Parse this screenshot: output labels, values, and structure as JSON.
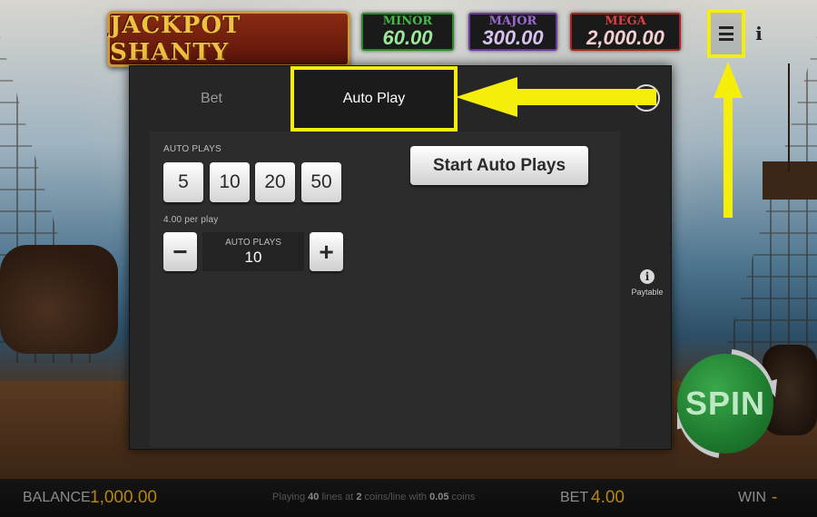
{
  "header": {
    "logo_text": "JACKPOT SHANTY",
    "jackpots": {
      "minor": {
        "label": "MINOR",
        "value": "60.00"
      },
      "major": {
        "label": "MAJOR",
        "value": "300.00"
      },
      "mega": {
        "label": "MEGA",
        "value": "2,000.00"
      }
    },
    "info_glyph": "i"
  },
  "panel": {
    "tabs": {
      "bet": "Bet",
      "auto_play": "Auto Play"
    },
    "active_tab": "Auto Play",
    "auto_plays_label": "AUTO PLAYS",
    "presets": [
      "5",
      "10",
      "20",
      "50"
    ],
    "per_play": "4.00 per play",
    "stepper": {
      "minus": "−",
      "label": "AUTO PLAYS",
      "value": "10",
      "plus": "+"
    },
    "start_button": "Start Auto Plays",
    "paytable": {
      "icon_glyph": "i",
      "label": "Paytable"
    }
  },
  "spin_button": "SPIN",
  "footer": {
    "balance_label": "BALANCE",
    "balance_value": "1,000.00",
    "info": {
      "pre": "Playing ",
      "lines": "40",
      "mid1": " lines at ",
      "coins": "2",
      "mid2": " coins/line with ",
      "coin_value": "0.05",
      "post": " coins"
    },
    "bet_label": "BET",
    "bet_value": "4.00",
    "win_label": "WIN",
    "win_value": "-"
  },
  "annotations": {
    "highlight_color": "#f5ee0a"
  },
  "icons": [
    "hamburger-menu-icon",
    "info-icon",
    "close-icon",
    "paytable-info-icon",
    "spin-arrows-icon"
  ]
}
